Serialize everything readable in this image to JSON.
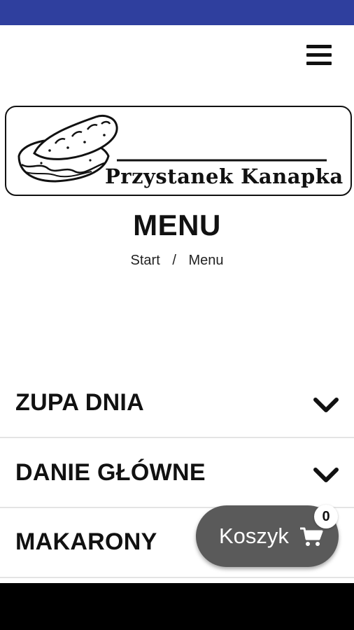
{
  "brand": {
    "name": "Przystanek Kanapka",
    "status_bar_color": "#2f3f9e"
  },
  "header": {
    "menu_icon": "hamburger-menu-icon"
  },
  "page": {
    "title": "MENU",
    "breadcrumb": {
      "items": [
        "Start",
        "Menu"
      ],
      "separator": "/"
    }
  },
  "sections": [
    {
      "label": "ZUPA DNIA",
      "icon": "chevron-down-icon",
      "expanded": false
    },
    {
      "label": "DANIE GŁÓWNE",
      "icon": "chevron-down-icon",
      "expanded": false
    },
    {
      "label": "MAKARONY",
      "icon": "chevron-down-icon",
      "expanded": false
    }
  ],
  "cart": {
    "label": "Koszyk",
    "icon": "shopping-cart-icon",
    "count": "0",
    "button_color": "#5a5a5a"
  }
}
